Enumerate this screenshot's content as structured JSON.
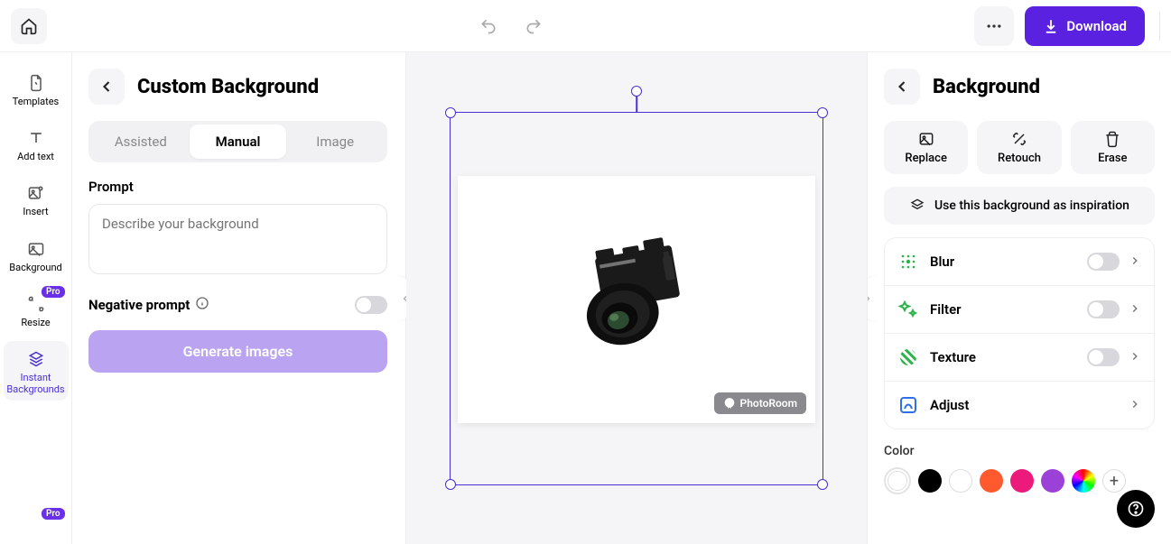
{
  "topbar": {
    "download_label": "Download"
  },
  "sidebar": {
    "items": [
      {
        "label": "Templates"
      },
      {
        "label": "Add text"
      },
      {
        "label": "Insert"
      },
      {
        "label": "Background"
      },
      {
        "label": "Resize",
        "badge": "Pro"
      },
      {
        "label": "Instant\nBackgrounds"
      }
    ],
    "partial_badge": "Pro"
  },
  "left_panel": {
    "title": "Custom Background",
    "tabs": [
      "Assisted",
      "Manual",
      "Image"
    ],
    "prompt_label": "Prompt",
    "prompt_placeholder": "Describe your background",
    "neg_prompt_label": "Negative prompt",
    "generate_label": "Generate images"
  },
  "canvas": {
    "watermark": "PhotoRoom"
  },
  "right_panel": {
    "title": "Background",
    "actions": [
      "Replace",
      "Retouch",
      "Erase"
    ],
    "inspiration": "Use this background as inspiration",
    "options": [
      "Blur",
      "Filter",
      "Texture",
      "Adjust"
    ],
    "color_label": "Color",
    "colors": [
      "#ffffff",
      "#000000",
      "#ffffff",
      "#ff5a2e",
      "#ec1a7a",
      "#9b41d8"
    ]
  }
}
